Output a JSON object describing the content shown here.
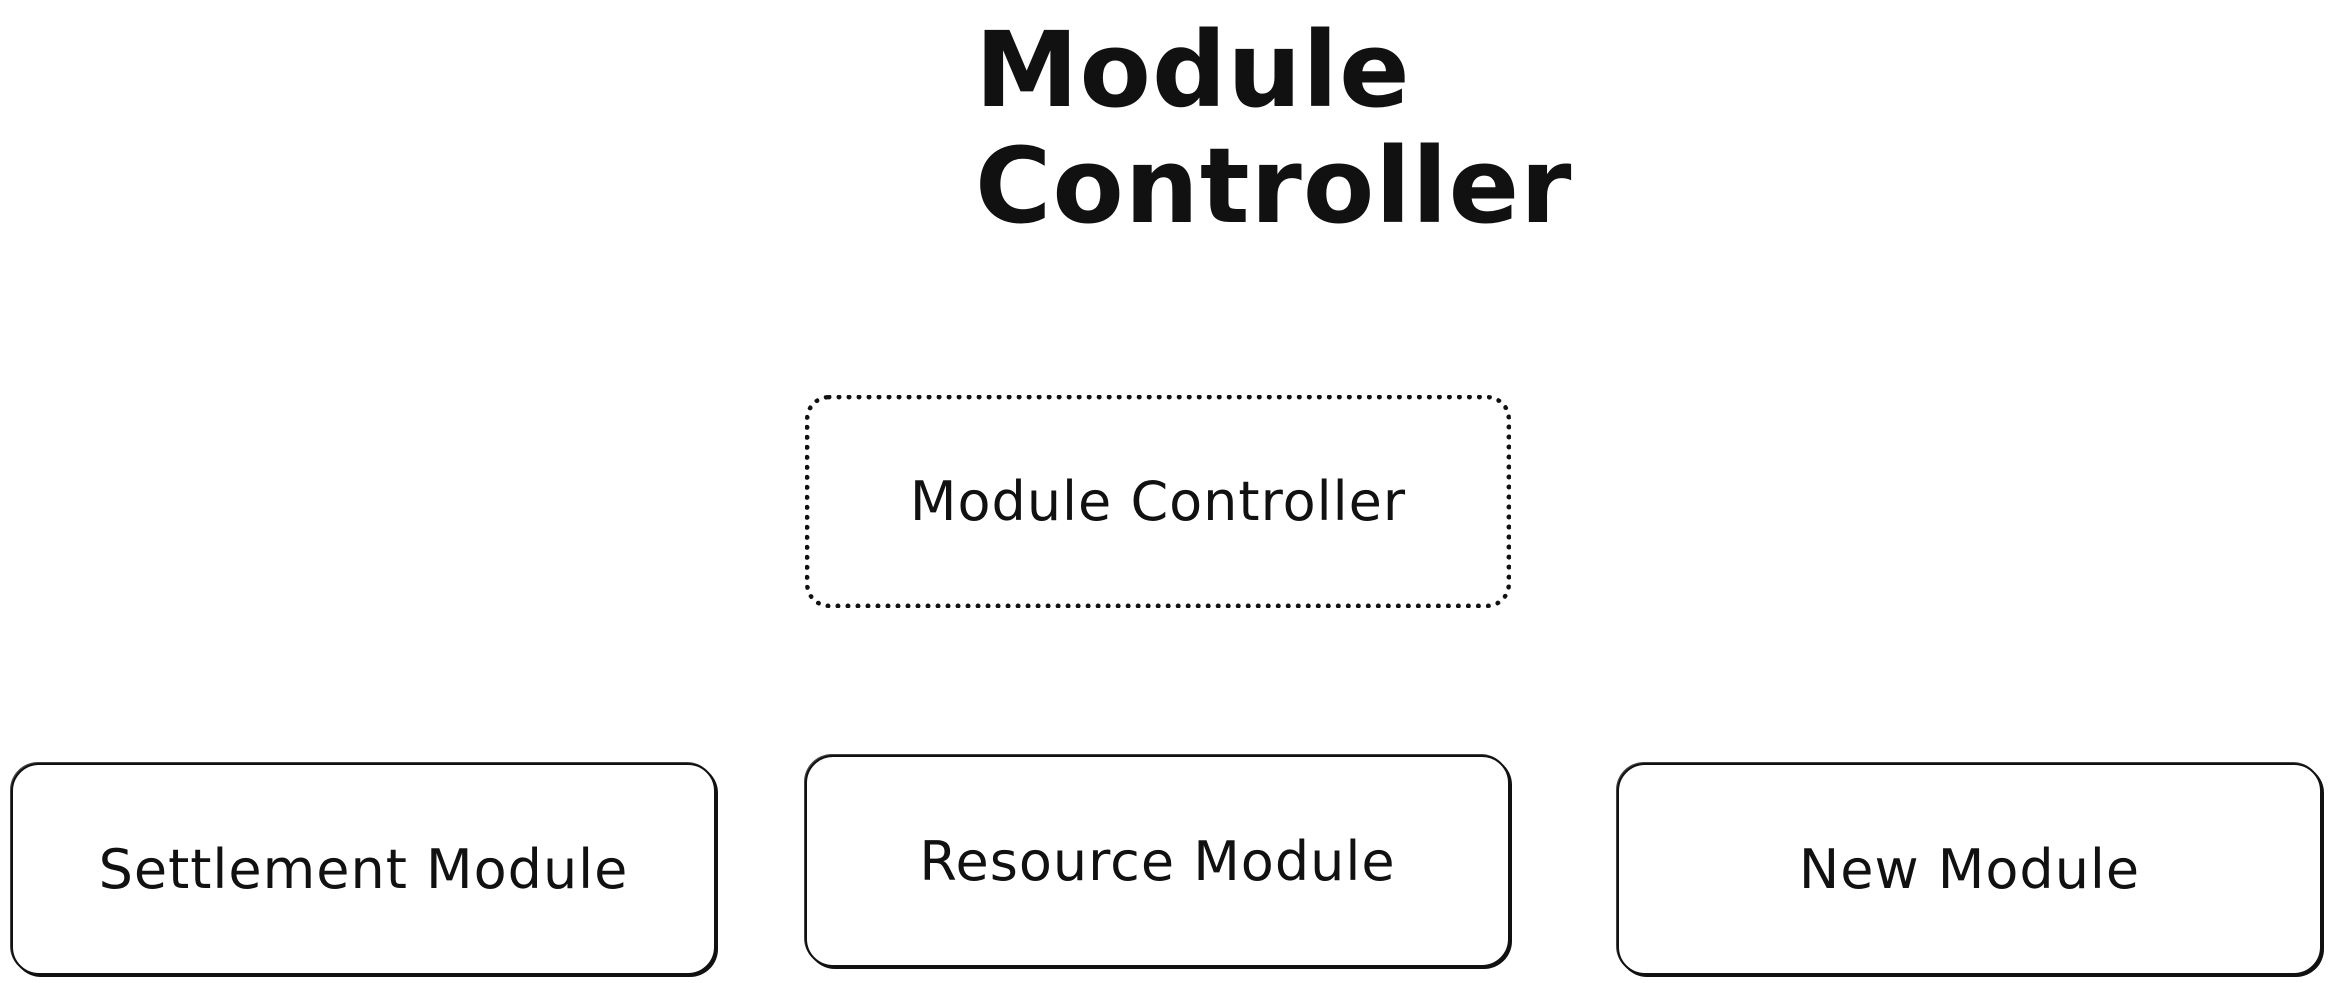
{
  "title": {
    "line1": "Module",
    "line2": "Controller"
  },
  "nodes": {
    "controller": "Module Controller",
    "settlement": "Settlement Module",
    "resource": "Resource Module",
    "new": "New Module"
  }
}
